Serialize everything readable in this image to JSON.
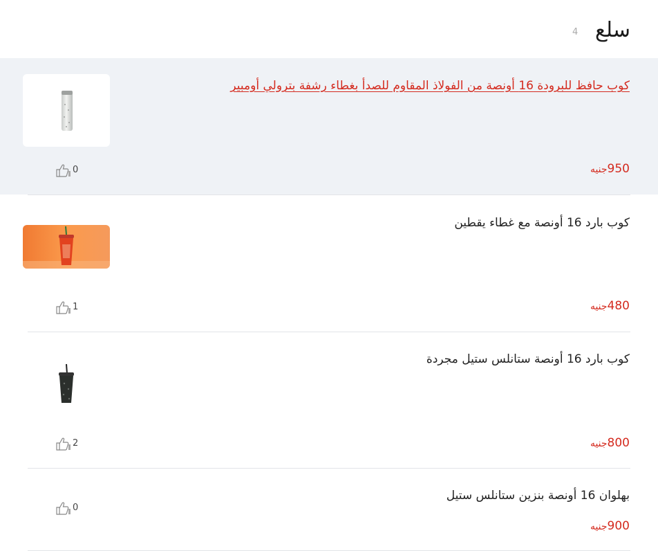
{
  "header": {
    "title": "سلع",
    "count": "4"
  },
  "items": [
    {
      "title": "كوب حافظ للبرودة 16 أونصة من الفولاذ المقاوم للصدأ بغطاء رشفة بترولي أومبير",
      "price": "950",
      "currency": "جنيه",
      "likes": "0",
      "image": "white-tumbler-image"
    },
    {
      "title": "كوب بارد 16 أونصة مع غطاء يقطين",
      "price": "480",
      "currency": "جنيه",
      "likes": "1",
      "image": "orange-cold-cup-image"
    },
    {
      "title": "كوب بارد 16 أونصة ستانلس ستيل مجردة",
      "price": "800",
      "currency": "جنيه",
      "likes": "2",
      "image": "black-cold-cup-image"
    },
    {
      "title": "بهلوان 16 أونصة بنزين ستانلس ستيل",
      "price": "900",
      "currency": "جنيه",
      "likes": "0",
      "image": ""
    }
  ],
  "colors": {
    "accent": "#d42a1e",
    "active_row_bg": "#eff2f6",
    "divider": "#e2e4e8"
  },
  "icons": {
    "like": "thumbs-up-icon"
  }
}
